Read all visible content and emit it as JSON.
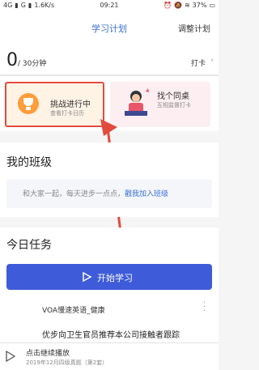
{
  "status_bar": {
    "network": "4G",
    "signal": "G",
    "speed": "1.6K/s",
    "time": "09:21",
    "battery": "37%"
  },
  "header": {
    "title": "学习计划",
    "right_action": "调整计划"
  },
  "progress": {
    "value": "0",
    "total": "/ 30分钟",
    "checkin_label": "打卡",
    "fraction": 0
  },
  "cards": {
    "challenge": {
      "title": "挑战进行中",
      "subtitle": "查看打卡日历"
    },
    "buddy": {
      "title": "找个同桌",
      "subtitle": "互相监督打卡"
    }
  },
  "my_class": {
    "title": "我的班级",
    "prompt": "和大家一起，每天进步一点点，",
    "link": "戳我加入班级"
  },
  "today_tasks": {
    "title": "今日任务",
    "start_button": "开始学习",
    "item": "VOA慢速英语_健康",
    "article_title": "优步向卫生官员推荐本公司接触者跟踪"
  },
  "player": {
    "title": "点击继续播放",
    "subtitle": "2019年12月四级真题（第2套）"
  },
  "colors": {
    "accent": "#3a6fd8",
    "button": "#3e5bd9",
    "highlight": "#e24b3c"
  }
}
